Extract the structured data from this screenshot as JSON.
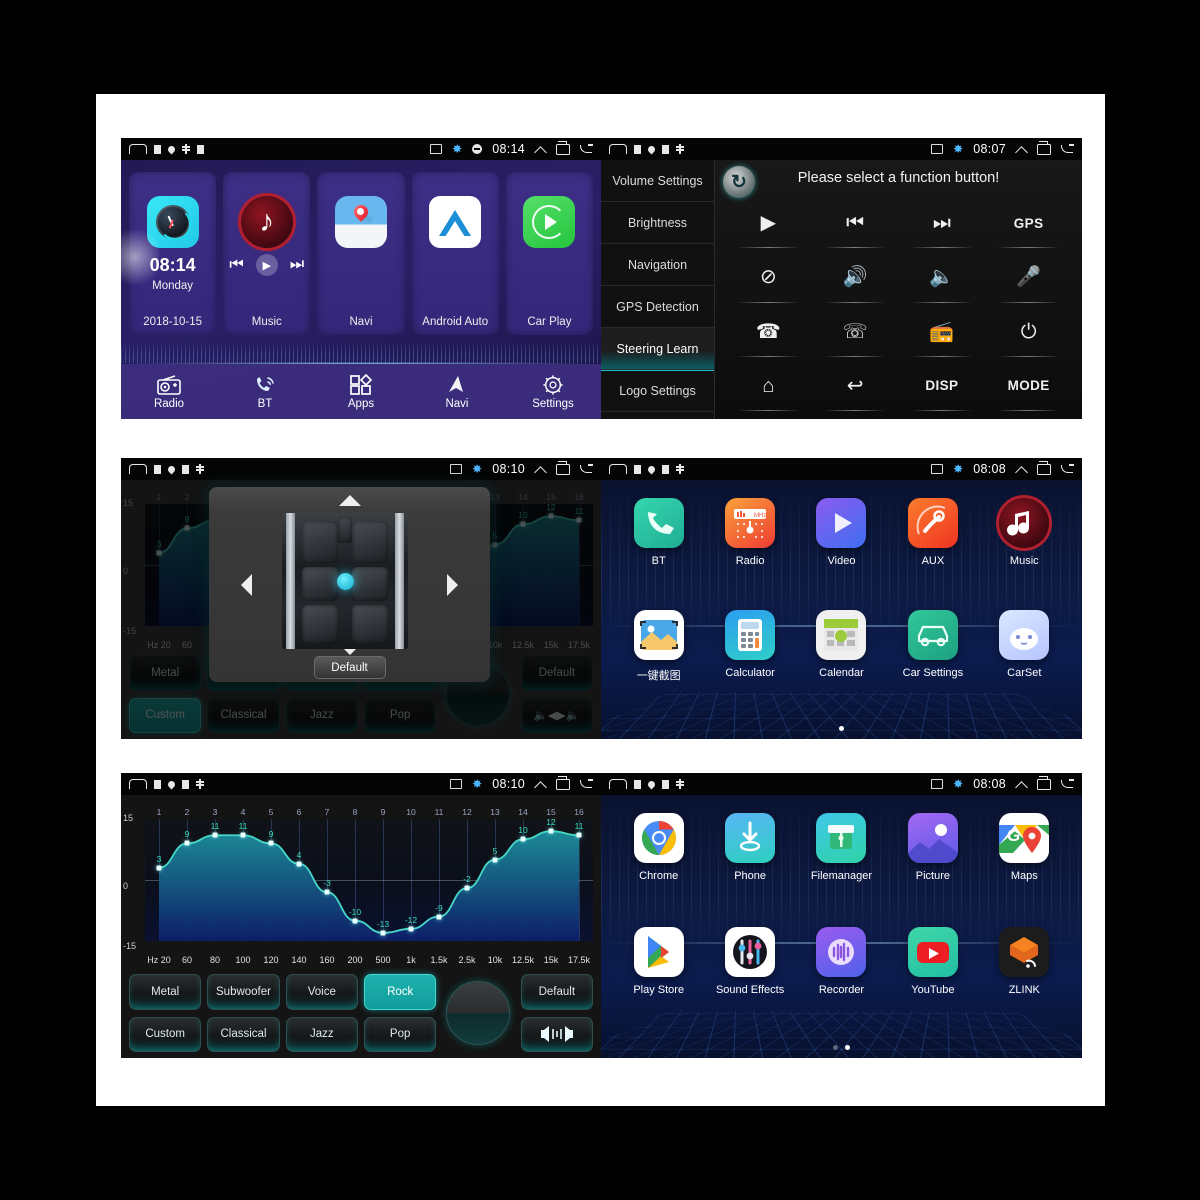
{
  "status_bars": {
    "left_icons": [
      "home-icon",
      "square-icon",
      "location-pin-icon",
      "asterisk-icon",
      "square-icon"
    ],
    "right_icons": [
      "screencast-icon",
      "bluetooth-icon",
      "do-not-disturb-icon"
    ],
    "nav_icons": [
      "chevron-up-icon",
      "recents-icon",
      "back-icon"
    ],
    "times": {
      "home": "08:14",
      "steering": "08:07",
      "fader": "08:10",
      "apps1": "08:08",
      "eq": "08:10",
      "apps2": "08:08"
    }
  },
  "home": {
    "clock": {
      "time": "08:14",
      "day": "Monday",
      "date": "2018-10-15"
    },
    "cards": [
      {
        "label": "",
        "icon": "clock-icon"
      },
      {
        "label": "Music",
        "icon": "music-note-icon"
      },
      {
        "label": "Navi",
        "icon": "map-pin-icon"
      },
      {
        "label": "Android Auto",
        "icon": "android-auto-icon"
      },
      {
        "label": "Car Play",
        "icon": "carplay-icon"
      }
    ],
    "media_controls": [
      "prev-icon",
      "play-icon",
      "next-icon"
    ],
    "dock": [
      {
        "label": "Radio",
        "icon": "radio-icon"
      },
      {
        "label": "BT",
        "icon": "bluetooth-phone-icon"
      },
      {
        "label": "Apps",
        "icon": "apps-grid-icon"
      },
      {
        "label": "Navi",
        "icon": "navigation-arrow-icon"
      },
      {
        "label": "Settings",
        "icon": "gear-icon"
      }
    ]
  },
  "steering": {
    "sidebar": [
      "Volume Settings",
      "Brightness",
      "Navigation",
      "GPS Detection",
      "Steering Learn",
      "Logo Settings"
    ],
    "active_sidebar": "Steering Learn",
    "title": "Please select a function button!",
    "refresh_icon": "refresh-icon",
    "buttons": [
      {
        "label": "",
        "icon": "play-icon",
        "glyph": "▶"
      },
      {
        "label": "",
        "icon": "previous-track-icon",
        "glyph": "⏮"
      },
      {
        "label": "",
        "icon": "next-track-icon",
        "glyph": "⏭"
      },
      {
        "label": "GPS",
        "icon": "gps-text-icon",
        "glyph": ""
      },
      {
        "label": "",
        "icon": "mute-icon",
        "glyph": "⊘"
      },
      {
        "label": "",
        "icon": "volume-up-icon",
        "glyph": "🔊+"
      },
      {
        "label": "",
        "icon": "volume-down-icon",
        "glyph": "🔊-"
      },
      {
        "label": "",
        "icon": "microphone-icon",
        "glyph": "🎤"
      },
      {
        "label": "",
        "icon": "call-answer-icon",
        "glyph": "✆"
      },
      {
        "label": "",
        "icon": "call-end-icon",
        "glyph": "✆"
      },
      {
        "label": "",
        "icon": "radio-icon",
        "glyph": "📻"
      },
      {
        "label": "",
        "icon": "power-icon",
        "glyph": "⏻"
      },
      {
        "label": "",
        "icon": "home-icon",
        "glyph": "⌂"
      },
      {
        "label": "",
        "icon": "back-icon",
        "glyph": "↩"
      },
      {
        "label": "DISP",
        "icon": "disp-text-icon",
        "glyph": ""
      },
      {
        "label": "MODE",
        "icon": "mode-text-icon",
        "glyph": ""
      }
    ]
  },
  "fader": {
    "dialog_default_label": "Default",
    "arrows": [
      "up-arrow-icon",
      "down-arrow-icon",
      "left-arrow-icon",
      "right-arrow-icon"
    ],
    "seat_image": "car-seats-top-view"
  },
  "equalizer": {
    "buttons_row1": [
      "Metal",
      "Subwoofer",
      "Voice",
      "Rock"
    ],
    "buttons_row2": [
      "Custom",
      "Classical",
      "Jazz",
      "Pop"
    ],
    "right_buttons": [
      "Default",
      "speaker-balance-icon"
    ],
    "selected_eq": "Rock",
    "selected_eq_behind_dialog": "Custom",
    "knob_icon": "balance-knob",
    "chart_data": {
      "type": "line",
      "title": "",
      "xlabel": "",
      "ylabel": "",
      "band_numbers": [
        1,
        2,
        3,
        4,
        5,
        6,
        7,
        8,
        9,
        10,
        11,
        12,
        13,
        14,
        15,
        16
      ],
      "categories": [
        "Hz 20",
        "60",
        "80",
        "100",
        "120",
        "140",
        "160",
        "200",
        "500",
        "1k",
        "1.5k",
        "2.5k",
        "10k",
        "12.5k",
        "15k",
        "17.5k"
      ],
      "values": [
        3,
        9,
        11,
        11,
        9,
        4,
        -3,
        -10,
        -13,
        -12,
        -9,
        -2,
        5,
        10,
        12,
        11
      ],
      "ylim": [
        -15,
        15
      ],
      "ytick_labels": [
        "15",
        "0",
        "-15"
      ],
      "grid": true,
      "legend": "none",
      "line_color": "#46d9c8",
      "fill_top_color": "#1c8f9c",
      "fill_bottom_color": "#0d1f6b"
    }
  },
  "apps_page_1": {
    "row1": [
      {
        "label": "BT",
        "icon": "bt-phone-icon"
      },
      {
        "label": "Radio",
        "icon": "radio-mhz-icon"
      },
      {
        "label": "Video",
        "icon": "video-play-icon"
      },
      {
        "label": "AUX",
        "icon": "aux-cable-icon"
      },
      {
        "label": "Music",
        "icon": "music-note-icon"
      }
    ],
    "row2": [
      {
        "label": "一键截图",
        "icon": "screenshot-icon"
      },
      {
        "label": "Calculator",
        "icon": "calculator-icon"
      },
      {
        "label": "Calendar",
        "icon": "calendar-icon"
      },
      {
        "label": "Car Settings",
        "icon": "car-settings-icon"
      },
      {
        "label": "CarSet",
        "icon": "carset-cloud-icon"
      }
    ],
    "page_dots": [
      true
    ]
  },
  "apps_page_2": {
    "row1": [
      {
        "label": "Chrome",
        "icon": "chrome-icon"
      },
      {
        "label": "Phone",
        "icon": "download-phone-icon"
      },
      {
        "label": "Filemanager",
        "icon": "filemanager-icon"
      },
      {
        "label": "Picture",
        "icon": "picture-icon"
      },
      {
        "label": "Maps",
        "icon": "google-maps-icon"
      }
    ],
    "row2": [
      {
        "label": "Play Store",
        "icon": "play-store-icon"
      },
      {
        "label": "Sound Effects",
        "icon": "sound-effects-icon"
      },
      {
        "label": "Recorder",
        "icon": "recorder-icon"
      },
      {
        "label": "YouTube",
        "icon": "youtube-icon"
      },
      {
        "label": "ZLINK",
        "icon": "zlink-icon"
      }
    ],
    "page_dots": [
      false,
      true
    ]
  }
}
